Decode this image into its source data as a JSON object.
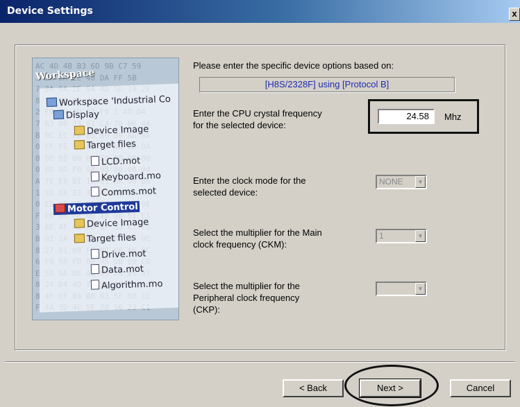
{
  "window": {
    "title": "Device Settings",
    "close_label": "x"
  },
  "intro": {
    "text": "Please enter the specific device options based on:",
    "device_info": "[H8S/2328F]  using  [Protocol B]"
  },
  "crystal": {
    "label_line1": "Enter the CPU crystal frequency",
    "label_line2": "for the selected device:",
    "value": "24.58",
    "unit": "Mhz"
  },
  "clock_mode": {
    "label_line1": "Enter the clock mode for the",
    "label_line2": "selected device:",
    "value": "NONE"
  },
  "main_multiplier": {
    "label_line1": "Select the multiplier for the Main",
    "label_line2": "clock frequency (CKM):",
    "value": "1"
  },
  "peripheral_multiplier": {
    "label_line1": "Select the multiplier for the",
    "label_line2": "Peripheral clock frequency",
    "label_line3": "(CKP):",
    "value": ""
  },
  "wizard_image": {
    "heading": "Workspace",
    "tree": {
      "workspace": "Workspace 'Industrial Co",
      "display": "Display",
      "device_image_1": "Device Image",
      "target_files_1": "Target files",
      "lcd": "LCD.mot",
      "keyboard": "Keyboard.mo",
      "comms": "Comms.mot",
      "motor_control": "Motor Control",
      "device_image_2": "Device Image",
      "target_files_2": "Target files",
      "drive": "Drive.mot",
      "data": "Data.mot",
      "algorithm": "Algorithm.mo"
    },
    "hex_lines": [
      "AC 4D 4B B3 6D 9B C7 59",
      "3 2A 9A 2E 48 DA FF 5B",
      "7 2A 9A 2E 9A 4D 5D 19 2E",
      "8 1A 7A 93 49 E5 67 C9 DD",
      "2 E9 E9 4D 38 F9 1 4D D4",
      "7 63 8B 33 91 C4 70 06 4A",
      "B 0C EC F0 B5 B9 00 AD BA",
      "0 FF FE 00 FF FF 00 00 DA",
      "0 00 00 00 00 00 00 00 00",
      "0 8D 6D F9 98 98 00 00 94",
      "A 7E E8 B1 17 01 DA 00 B6",
      "1 5E 8A 33 37 EC 00 F6 C5",
      "0 E2 A8 9E 95 60 15 2E 9E",
      "F E6 86 6E 08 AD 9D 51 E1",
      "3 8E 4F 62 A6 BF 33 E7 F5",
      "B 92 1A 2C 07 62 D4 85 0C",
      "8 27 91 08 F4 00 06 A6 9C",
      "6 F0 58 FD 0D 95 DB 09 C0",
      "E 5D 9A DE A9 C5 64 85 97",
      "8 24 D4 4D 75 54 AD 2D F6",
      "8 4F EF 84 B0 63 5F 68 1E",
      "F 4A 3D 4C 5E 78 56 23 C1"
    ]
  },
  "buttons": {
    "back": "< Back",
    "next": "Next >",
    "cancel": "Cancel"
  }
}
